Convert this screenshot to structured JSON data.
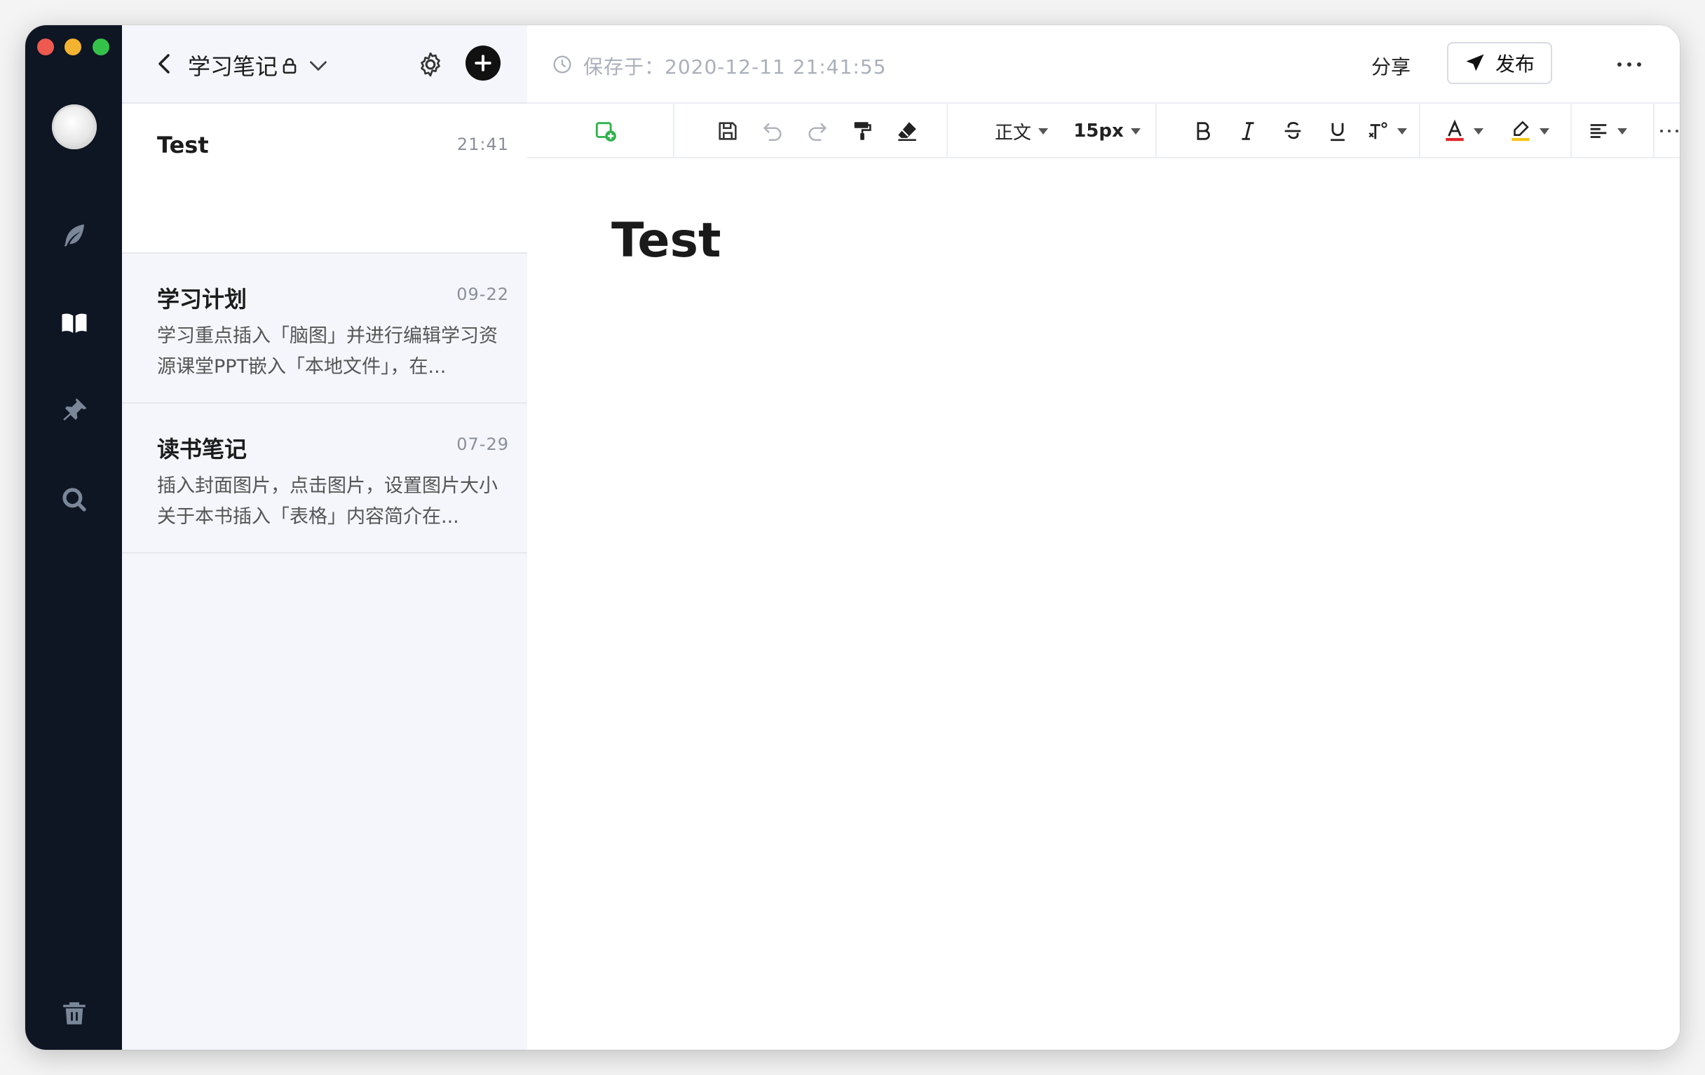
{
  "sidebar": {
    "icons": [
      "avatar",
      "feather-icon",
      "book-icon",
      "pin-icon",
      "search-icon",
      "trash-icon"
    ]
  },
  "notebook": {
    "title": "学习笔记"
  },
  "notes": [
    {
      "title": "Test",
      "time": "21:41",
      "snippet": "",
      "selected": true
    },
    {
      "title": "学习计划",
      "time": "09-22",
      "snippet": "学习重点插入「脑图」并进行编辑学习资源课堂PPT嵌入「本地文件」，在...",
      "selected": false
    },
    {
      "title": "读书笔记",
      "time": "07-29",
      "snippet": "插入封面图片，点击图片，设置图片大小关于本书插入「表格」内容简介在...",
      "selected": false
    }
  ],
  "header": {
    "save_status": "保存于：2020-12-11 21:41:55",
    "share_label": "分享",
    "publish_label": "发布"
  },
  "toolbar": {
    "style_label": "正文",
    "font_size_label": "15px",
    "colors": {
      "text_color": "#e0262b",
      "highlight_color": "#f5c518",
      "insert_icon_green": "#2fb24a"
    }
  },
  "document": {
    "title": "Test"
  }
}
